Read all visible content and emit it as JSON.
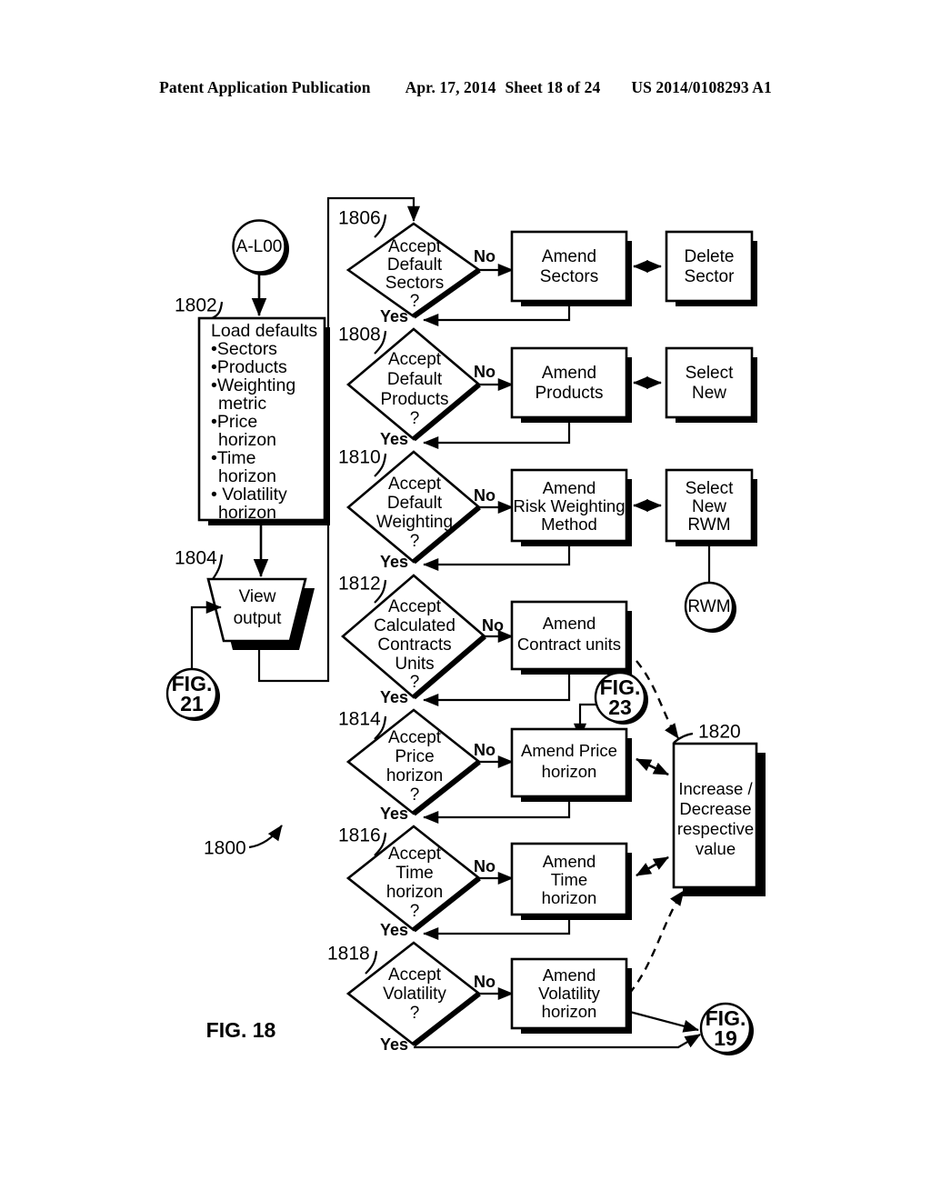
{
  "header": {
    "left": "Patent Application Publication",
    "date": "Apr. 17, 2014",
    "sheet": "Sheet 18 of 24",
    "pubnum": "US 2014/0108293 A1"
  },
  "figure": {
    "label": "FIG. 18",
    "ref": "1800",
    "start_connector": "A-L00",
    "load_box": {
      "ref": "1802",
      "title": "Load defaults",
      "items": [
        "•Sectors",
        "•Products",
        "•Weighting",
        "metric",
        "•Price",
        "horizon",
        "•Time",
        "horizon",
        "• Volatility",
        "horizon"
      ]
    },
    "view_output": {
      "ref": "1804",
      "line1": "View",
      "line2": "output"
    },
    "connectors": {
      "fig21": [
        "FIG.",
        "21"
      ],
      "fig23": [
        "FIG.",
        "23"
      ],
      "fig19": [
        "FIG.",
        "19"
      ],
      "rwm": "RWM"
    },
    "increase_box": {
      "ref": "1820",
      "lines": [
        "Increase /",
        "Decrease",
        "respective",
        "value"
      ]
    },
    "yes_label": "Yes",
    "no_label": "No",
    "rows": [
      {
        "ref": "1806",
        "decision": [
          "Accept",
          "Default",
          "Sectors",
          "?"
        ],
        "amend": [
          "Amend",
          "Sectors"
        ],
        "aux": [
          "Delete",
          "Sector"
        ]
      },
      {
        "ref": "1808",
        "decision": [
          "Accept",
          "Default",
          "Products",
          "?"
        ],
        "amend": [
          "Amend",
          "Products"
        ],
        "aux": [
          "Select",
          "New"
        ]
      },
      {
        "ref": "1810",
        "decision": [
          "Accept",
          "Default",
          "Weighting",
          "?"
        ],
        "amend": [
          "Amend",
          "Risk Weighting",
          "Method"
        ],
        "aux": [
          "Select",
          "New",
          "RWM"
        ]
      },
      {
        "ref": "1812",
        "decision": [
          "Accept",
          "Calculated",
          "Contracts",
          "Units",
          "?"
        ],
        "amend": [
          "Amend",
          "Contract units"
        ],
        "aux": []
      },
      {
        "ref": "1814",
        "decision": [
          "Accept",
          "Price",
          "horizon",
          "?"
        ],
        "amend": [
          "Amend Price",
          "horizon"
        ],
        "aux": []
      },
      {
        "ref": "1816",
        "decision": [
          "Accept",
          "Time",
          "horizon",
          "?"
        ],
        "amend": [
          "Amend",
          "Time",
          "horizon"
        ],
        "aux": []
      },
      {
        "ref": "1818",
        "decision": [
          "Accept",
          "Volatility",
          "?"
        ],
        "amend": [
          "Amend",
          "Volatility",
          "horizon"
        ],
        "aux": []
      }
    ]
  }
}
